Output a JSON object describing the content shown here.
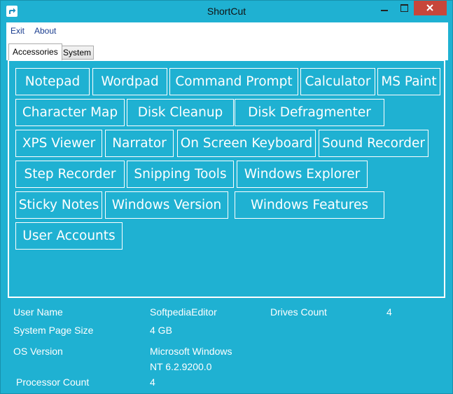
{
  "window": {
    "title": "ShortCut",
    "icon": "shortcut-arrow-icon"
  },
  "menu": {
    "items": [
      "Exit",
      "About"
    ]
  },
  "tabs": [
    {
      "label": "Accessories",
      "active": true
    },
    {
      "label": "System",
      "active": false
    }
  ],
  "shortcuts": [
    "Notepad",
    "Wordpad",
    "Command Prompt",
    "Calculator",
    "MS Paint",
    "Character Map",
    "Disk Cleanup",
    "Disk Defragmenter",
    "XPS Viewer",
    "Narrator",
    "On Screen Keyboard",
    "Sound Recorder",
    "Step Recorder",
    "Snipping Tools",
    "Windows Explorer",
    "Sticky Notes",
    "Windows Version",
    "Windows Features",
    "User Accounts"
  ],
  "system_info": {
    "user_name": {
      "label": "User Name",
      "value": "SoftpediaEditor"
    },
    "drives_count": {
      "label": "Drives Count",
      "value": "4"
    },
    "page_size": {
      "label": "System Page Size",
      "value": "4 GB"
    },
    "os_version": {
      "label": "OS Version",
      "value_line1": "Microsoft Windows",
      "value_line2": "NT 6.2.9200.0"
    },
    "processor_count": {
      "label": "Processor Count",
      "value": "4"
    }
  },
  "colors": {
    "accent": "#1fb1d2",
    "close": "#c7463a",
    "menu_text": "#1a3d8f"
  }
}
